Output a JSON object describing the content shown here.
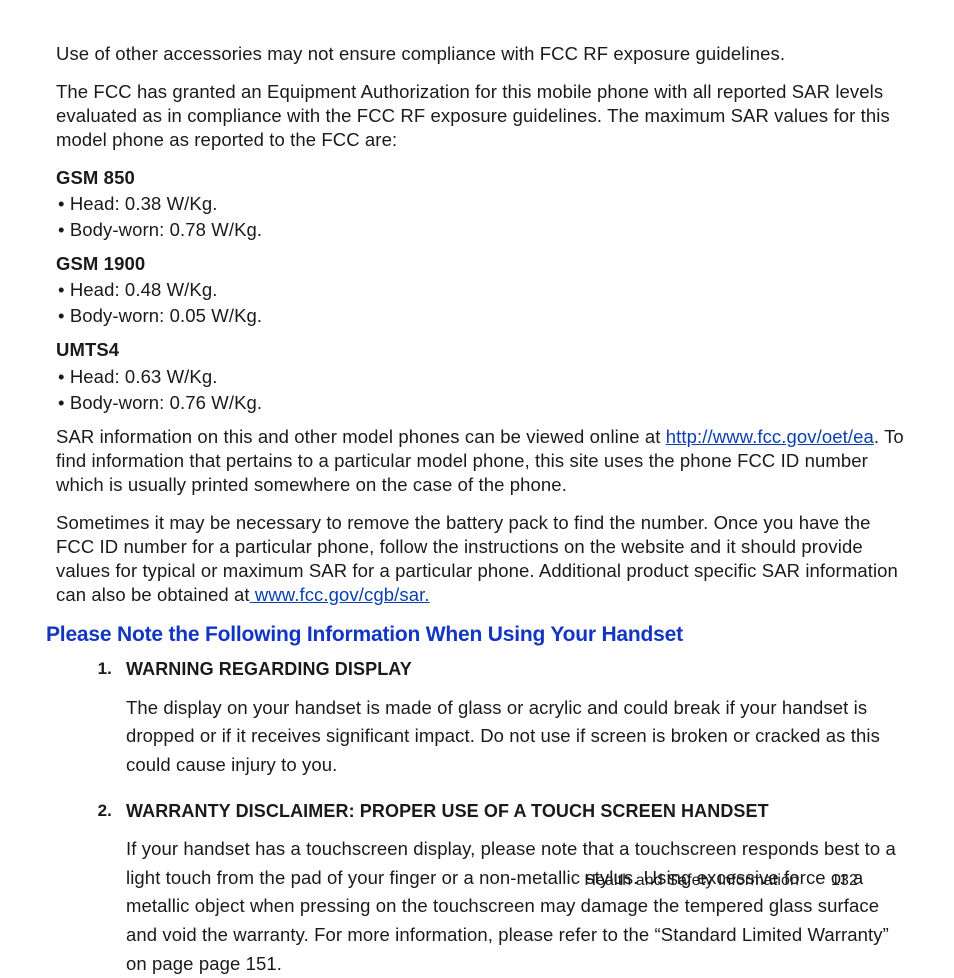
{
  "p1": "Use of other accessories may not ensure compliance with FCC RF exposure guidelines.",
  "p2": "The FCC has granted an Equipment Authorization for this mobile phone with all reported SAR levels evaluated as in compliance with the FCC RF exposure guidelines. The maximum SAR values for this model phone as reported to the FCC are:",
  "s1": {
    "title": "GSM 850",
    "b1": "Head: 0.38 W/Kg.",
    "b2": "Body-worn: 0.78 W/Kg."
  },
  "s2": {
    "title": "GSM 1900",
    "b1": "Head: 0.48 W/Kg.",
    "b2": "Body-worn: 0.05 W/Kg."
  },
  "s3": {
    "title": "UMTS4",
    "b1": "Head: 0.63 W/Kg.",
    "b2": "Body-worn: 0.76 W/Kg."
  },
  "p3a": "SAR information on this and other model phones can be viewed online at ",
  "p3link": "http://www.fcc.gov/oet/ea",
  "p3b": ". To find information that pertains to a particular model phone, this site uses the phone FCC ID number which is usually printed somewhere on the case of the phone.",
  "p4a": "Sometimes it may be necessary to remove the battery pack to find the number. Once you have the FCC ID number for a particular phone, follow the instructions on the website and it should provide values for typical or maximum SAR for a particular phone. Additional product specific SAR information can also be obtained at",
  "p4link": " www.fcc.gov/cgb/sar. ",
  "subhead": "Please Note the Following Information When Using Your Handset",
  "i1": {
    "num": "1.",
    "hd": "WARNING REGARDING DISPLAY",
    "txt": "The display on your handset is made of glass or acrylic and could break if your handset is dropped or if it receives significant impact. Do not use if screen is broken or cracked as this could cause injury to you."
  },
  "i2": {
    "num": "2.",
    "hd": "WARRANTY DISCLAIMER: PROPER USE OF A TOUCH SCREEN HANDSET",
    "txt": "If your handset has a touchscreen display, please note that a touchscreen responds best to a light touch from the pad of your finger or a non-metallic stylus. Using excessive force or a metallic object when pressing on the touchscreen may damage the tempered glass surface and void the warranty. For more information, please refer to the “Standard Limited Warranty” on page page 151."
  },
  "footer": {
    "section": "Health and Safety Information",
    "page": "132"
  }
}
